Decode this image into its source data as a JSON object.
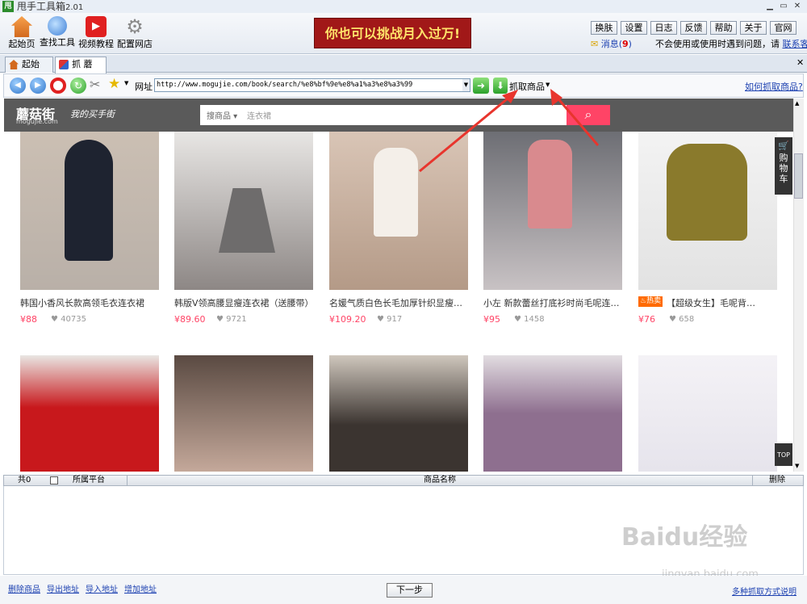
{
  "window": {
    "title": "甩手工具箱",
    "version": "2.01",
    "logo": "甩"
  },
  "toolbar": {
    "items": [
      {
        "label": "起始页",
        "icon": "home-icon",
        "color": "#d2691e"
      },
      {
        "label": "查找工具",
        "icon": "search-icon",
        "color": "#3d7fd6"
      },
      {
        "label": "视频教程",
        "icon": "play-icon",
        "color": "#e02020"
      },
      {
        "label": "配置网店",
        "icon": "gear-icon",
        "color": "#8a8a8a"
      }
    ],
    "banner": "你也可以挑战月入过万!",
    "right_buttons": [
      "换肤",
      "设置",
      "日志",
      "反馈",
      "帮助",
      "关于",
      "官网"
    ],
    "message_label": "消息(",
    "message_count": "9",
    "message_close": ")",
    "notice": "不会使用或使用时遇到问题，请",
    "support_link": "联系客服"
  },
  "tabs": [
    {
      "label": "起始页",
      "active": false
    },
    {
      "label": "抓 蘑菇街",
      "active": true
    }
  ],
  "navbar": {
    "address_label": "网址",
    "url": "http://www.mogujie.com/book/search/%e8%bf%9e%e8%a1%a3%e8%a3%99",
    "grab_label": "抓取商品",
    "howto_link": "如何抓取商品?"
  },
  "site": {
    "logo": "蘑菇街",
    "logo_sub": "mogujie.com",
    "slogan": "我的买手街",
    "search_scope": "搜商品",
    "search_placeholder": "连衣裙",
    "cart_label": "购物车",
    "top_label": "TOP",
    "hot_badge": "热卖"
  },
  "products": [
    {
      "title": "韩国小香风长款高领毛衣连衣裙",
      "price": "¥88",
      "likes": "40735",
      "color": "#b9b0a8"
    },
    {
      "title": "韩版V领高腰显瘦连衣裙（送腰带）",
      "price": "¥89.60",
      "likes": "9721",
      "color": "#8d8785"
    },
    {
      "title": "名媛气质白色长毛加厚针织显瘦…",
      "price": "¥109.20",
      "likes": "917",
      "color": "#c7b2a3"
    },
    {
      "title": "小左 新款蕾丝打底衫时尚毛呢连…",
      "price": "¥95",
      "likes": "1458",
      "color": "#c98d8e"
    },
    {
      "title": "【超级女生】毛呢背…",
      "price": "¥76",
      "likes": "658",
      "color": "#8a7a2c",
      "hot": true
    },
    {
      "title": "",
      "color": "#c8181c"
    },
    {
      "title": "",
      "color": "#7a6a5d"
    },
    {
      "title": "",
      "color": "#3b3430"
    },
    {
      "title": "",
      "color": "#8e6f8f"
    },
    {
      "title": "",
      "color": "#e6e4ec"
    }
  ],
  "list": {
    "headers": {
      "total": "共0",
      "platform": "所属平台",
      "name": "商品名称",
      "delete": "删除"
    }
  },
  "bottom": {
    "links": [
      "删除商品",
      "导出地址",
      "导入地址",
      "增加地址"
    ],
    "next": "下一步",
    "modes_link": "多种抓取方式说明"
  },
  "watermark": {
    "text": "Baidu经验",
    "sub": "jingyan.baidu.com"
  }
}
